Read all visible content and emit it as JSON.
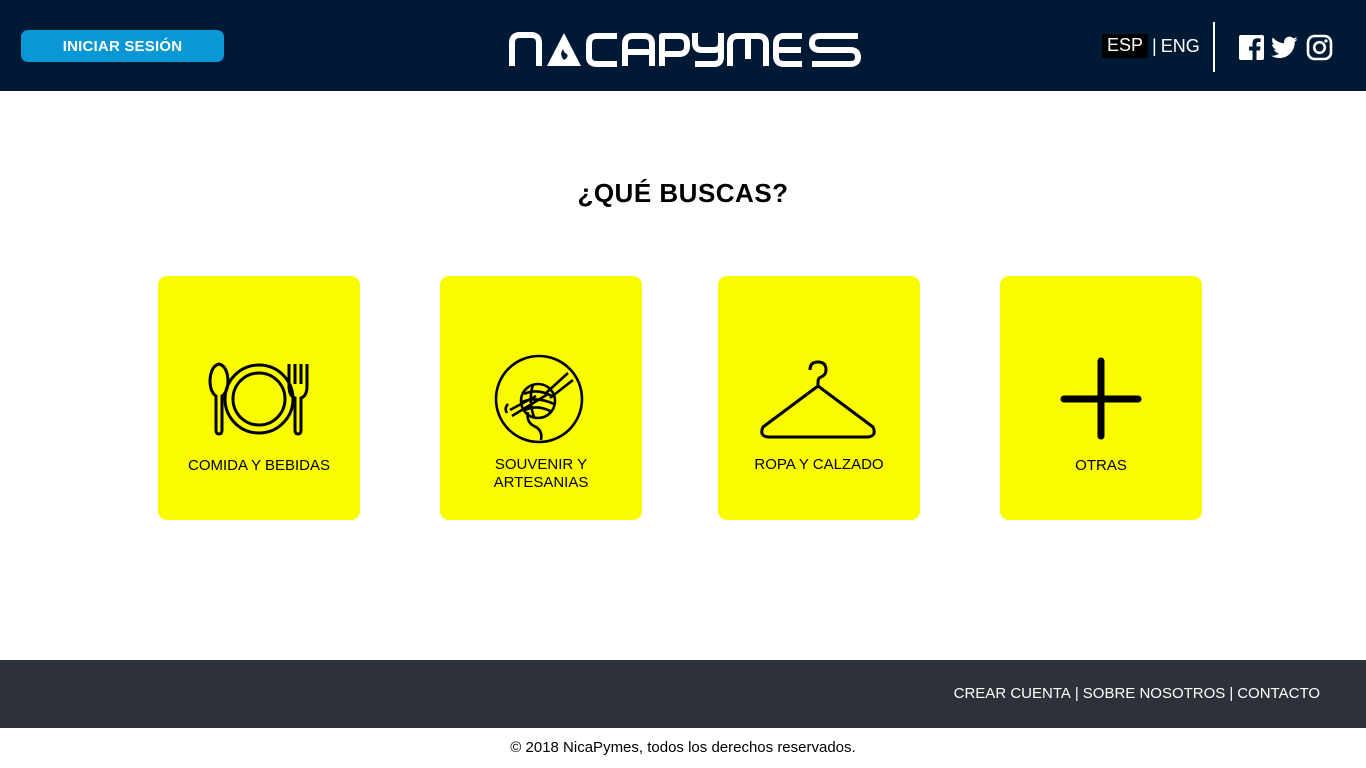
{
  "header": {
    "login_label": "INICIAR SESIÓN",
    "logo_text": "NicaPymes",
    "lang_active": "ESP",
    "lang_separator": "|",
    "lang_other": "ENG",
    "social": [
      "facebook-icon",
      "twitter-icon",
      "instagram-icon"
    ]
  },
  "main": {
    "title": "¿QUÉ BUSCAS?",
    "categories": [
      {
        "line1": "COMIDA Y BEBIDAS",
        "line2": "",
        "icon": "cutlery-plate-icon"
      },
      {
        "line1": "SOUVENIR Y",
        "line2": "ARTESANIAS",
        "icon": "yarn-ball-icon"
      },
      {
        "line1": "ROPA Y CALZADO",
        "line2": "",
        "icon": "hanger-icon"
      },
      {
        "line1": "OTRAS",
        "line2": "",
        "icon": "plus-icon"
      }
    ]
  },
  "footer": {
    "links": [
      "CREAR CUENTA",
      "SOBRE NOSOTROS",
      "CONTACTO"
    ],
    "separator": "|",
    "copyright": "© 2018 NicaPymes, todos los derechos reservados."
  },
  "colors": {
    "header_bg": "#001a35",
    "login_button": "#0a97d6",
    "card": "#fbfb00",
    "footer_bg": "#2d3139"
  }
}
